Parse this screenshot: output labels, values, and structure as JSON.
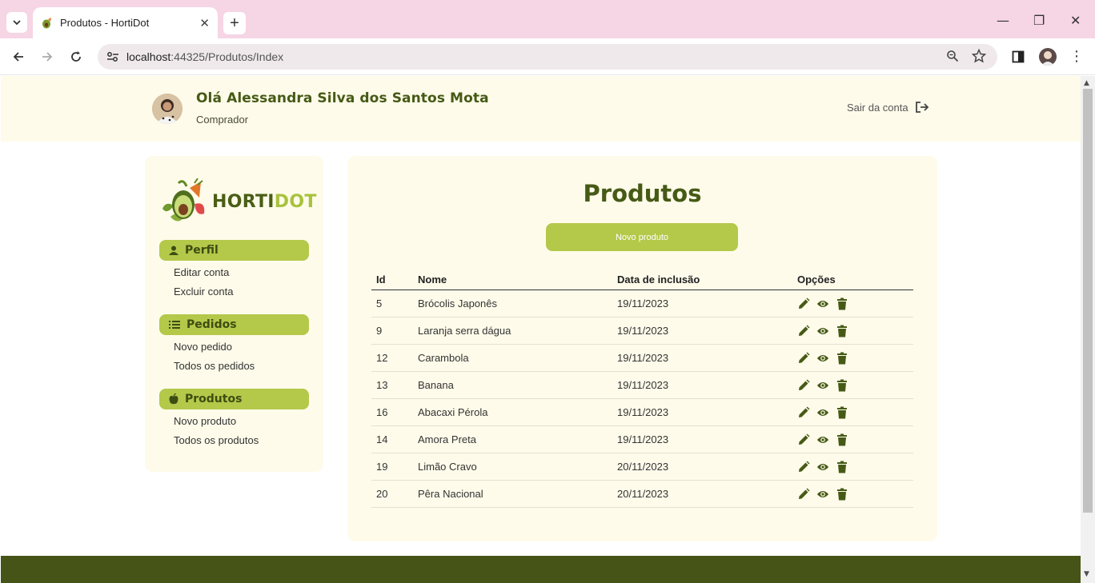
{
  "browser": {
    "tab_title": "Produtos - HortiDot",
    "url_host": "localhost",
    "url_path": ":44325/Produtos/Index"
  },
  "header": {
    "greeting": "Olá Alessandra Silva dos Santos Mota",
    "role": "Comprador",
    "logout_label": "Sair da conta"
  },
  "sidebar": {
    "logo_part1": "HORTI",
    "logo_part2": "DOT",
    "sections": [
      {
        "label": "Perfil",
        "icon": "user-icon",
        "links": [
          "Editar conta",
          "Excluir conta"
        ]
      },
      {
        "label": "Pedidos",
        "icon": "list-icon",
        "links": [
          "Novo pedido",
          "Todos os pedidos"
        ]
      },
      {
        "label": "Produtos",
        "icon": "apple-icon",
        "links": [
          "Novo produto",
          "Todos os produtos"
        ]
      }
    ]
  },
  "main": {
    "title": "Produtos",
    "new_button": "Novo produto",
    "columns": [
      "Id",
      "Nome",
      "Data de inclusão",
      "Opções"
    ],
    "rows": [
      {
        "id": "5",
        "nome": "Brócolis Japonês",
        "data": "19/11/2023"
      },
      {
        "id": "9",
        "nome": "Laranja serra dágua",
        "data": "19/11/2023"
      },
      {
        "id": "12",
        "nome": "Carambola",
        "data": "19/11/2023"
      },
      {
        "id": "13",
        "nome": "Banana",
        "data": "19/11/2023"
      },
      {
        "id": "16",
        "nome": "Abacaxi Pérola",
        "data": "19/11/2023"
      },
      {
        "id": "14",
        "nome": "Amora Preta",
        "data": "19/11/2023"
      },
      {
        "id": "19",
        "nome": "Limão Cravo",
        "data": "20/11/2023"
      },
      {
        "id": "20",
        "nome": "Pêra Nacional",
        "data": "20/11/2023"
      }
    ]
  },
  "colors": {
    "brand_dark": "#465a16",
    "brand_light": "#b4c84a",
    "cream": "#fefbea",
    "footer": "#465418"
  }
}
